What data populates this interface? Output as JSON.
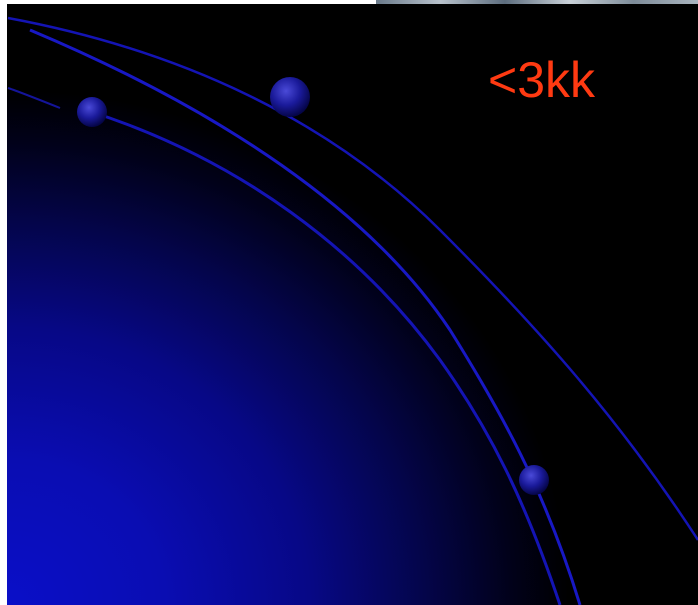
{
  "slide": {
    "label": "<3kk",
    "label_color": "#ff3a12",
    "background_color": "#000000",
    "glow_color": "#0a0fc8",
    "arc_color": "#1414b4",
    "bead_color": "#1a1a9a"
  }
}
